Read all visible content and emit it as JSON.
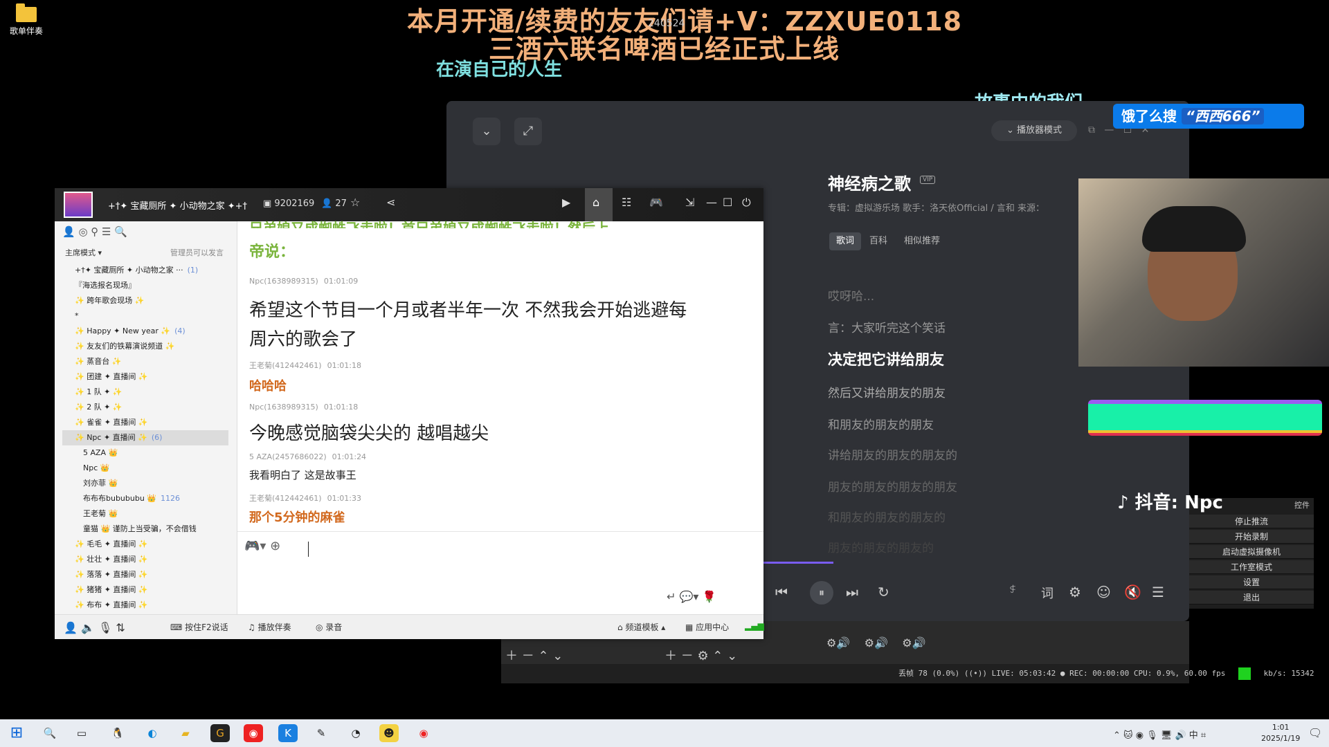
{
  "desktop": {
    "icon_label": "歌单伴奏"
  },
  "overlay": {
    "line1": "本月开通/续费的友友们请+V：ZZXUE0118",
    "line2": "三酒六联名啤酒已经正式上线",
    "small": "240524",
    "lyric_left": "在演自己的人生",
    "lyric_right": "故事中的我们"
  },
  "player": {
    "mode_label": "播放器模式",
    "song_title": "神经病之歌",
    "vip": "VIP",
    "meta": "专辑：虚拟游乐场    歌手：洛天依Official / 言和    来源：",
    "tabs": [
      "歌词",
      "百科",
      "相似推荐"
    ],
    "lyrics": [
      "哎呀哈...",
      "言：大家听完这个笑话",
      "决定把它讲给朋友",
      "然后又讲给朋友的朋友",
      "和朋友的朋友的朋友",
      "讲给朋友的朋友的朋友的",
      "朋友的朋友的朋友的朋友",
      "和朋友的朋友的朋友的",
      "朋友的朋友的朋友的"
    ],
    "progress": 0.1,
    "ctl_btn": "ꐱ",
    "ctl_lyric": "词"
  },
  "obs": {
    "status": "丢帧 78 (0.0%)   ((•)) LIVE: 05:03:42   ● REC: 00:00:00     CPU: 0.9%, 60.00 fps",
    "kbs": "kb/s: 15342",
    "menu": [
      "停止推流",
      "开始录制",
      "启动虚拟摄像机",
      "工作室模式",
      "设置",
      "退出"
    ],
    "menu_header": "控件"
  },
  "stream": {
    "eleme": "饿了么搜",
    "eleme_tag": "“西西666”",
    "douyin": "抖音: Npc"
  },
  "yy": {
    "title": "+†✦ 宝藏厕所 ✦ 小动物之家 ✦+†",
    "id": "9202169",
    "users": "27",
    "mode": "主席模式",
    "admin_note": "管理员可以发言",
    "channels": [
      {
        "label": "+†✦ 宝藏厕所 ✦ 小动物之家 ···",
        "count": "(1)"
      },
      {
        "label": "『海选报名现场』",
        "count": ""
      },
      {
        "label": "✨   跨年歌会现场   ✨",
        "count": ""
      },
      {
        "label": "*",
        "count": ""
      },
      {
        "label": "✨ Happy ✦ New year ✨",
        "count": "(4)"
      },
      {
        "label": "✨ 友友们的铁幕演说频道 ✨",
        "count": ""
      },
      {
        "label": "✨   蒸音台   ✨",
        "count": ""
      },
      {
        "label": "✨  团建 ✦ 直播间  ✨",
        "count": ""
      },
      {
        "label": "✨  1  队  ✦  ✨",
        "count": ""
      },
      {
        "label": "✨  2  队  ✦  ✨",
        "count": ""
      },
      {
        "label": "✨  雀雀 ✦ 直播间  ✨",
        "count": ""
      },
      {
        "label": "✨  Npc ✦ 直播间  ✨",
        "count": "(6)"
      },
      {
        "label": "5 AZA 👑",
        "count": ""
      },
      {
        "label": "Npc 👑",
        "count": ""
      },
      {
        "label": "刘亦菲 👑",
        "count": ""
      },
      {
        "label": "布布布bubububu 👑",
        "count": "1126"
      },
      {
        "label": "王老菊 👑",
        "count": ""
      },
      {
        "label": "童猫 👑 谨防上当受骗，不会借钱",
        "count": ""
      },
      {
        "label": "✨  毛毛 ✦ 直播间  ✨",
        "count": ""
      },
      {
        "label": "✨  壮壮 ✦ 直播间  ✨",
        "count": ""
      },
      {
        "label": "✨  落落 ✦ 直播间  ✨",
        "count": ""
      },
      {
        "label": "✨  猪猪 ✦ 直播间  ✨",
        "count": ""
      },
      {
        "label": "✨  布布 ✦ 直播间  ✨",
        "count": ""
      }
    ],
    "chat": [
      {
        "name": "",
        "time": "",
        "text": "帝说：",
        "style": "green"
      },
      {
        "name": "Npc(1638989315)",
        "time": "01:01:09",
        "text": "希望这个节目一个月或者半年一次  不然我会开始逃避每",
        "style": "big"
      },
      {
        "name": "",
        "time": "",
        "text": "周六的歌会了",
        "style": "big"
      },
      {
        "name": "王老菊(412442461)",
        "time": "01:01:18",
        "text": "哈哈哈",
        "style": "orange"
      },
      {
        "name": "Npc(1638989315)",
        "time": "01:01:18",
        "text": "今晚感觉脑袋尖尖的  越唱越尖",
        "style": "big"
      },
      {
        "name": "5 AZA(2457686022)",
        "time": "01:01:24",
        "text": "我看明白了  这是故事王",
        "style": "small"
      },
      {
        "name": "王老菊(412442461)",
        "time": "01:01:33",
        "text": "那个5分钟的麻雀",
        "style": "orange"
      }
    ],
    "chat_top_cut": "兄弟娘又成蜘蛛飞走啦！首兄弟娘又成蜘蛛飞走啦！然后上",
    "bottom": {
      "f2": "按住F2说话",
      "accomp": "播放伴奏",
      "record": "录音",
      "template": "频道模板",
      "apps": "应用中心"
    }
  },
  "taskbar": {
    "time": "1:01",
    "date": "2025/1/19",
    "ime": "中"
  }
}
